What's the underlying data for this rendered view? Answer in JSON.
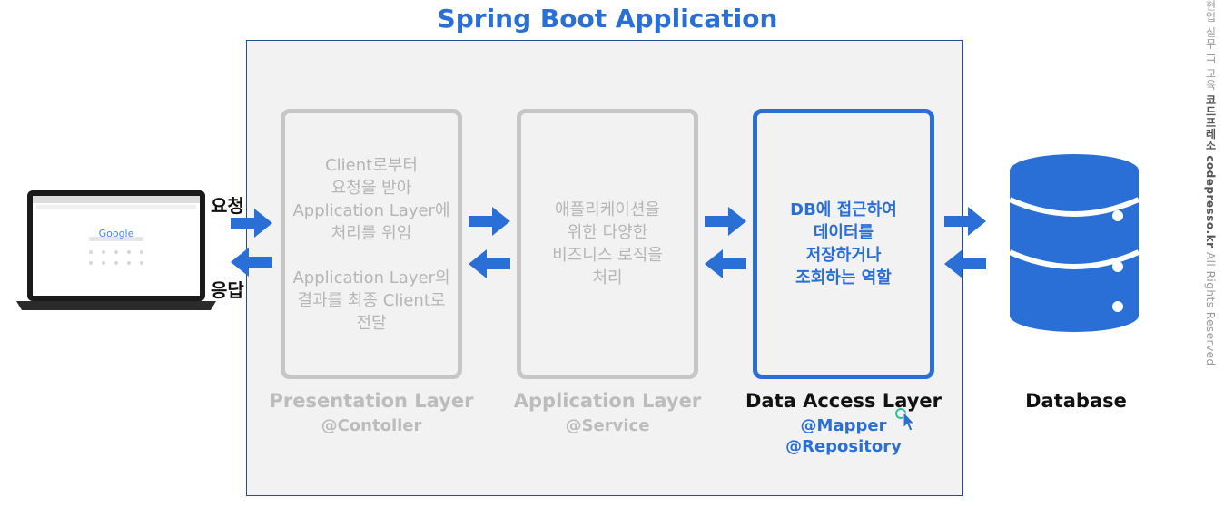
{
  "title": "Spring Boot Application",
  "client": {
    "request_label": "요청",
    "response_label": "응답",
    "screen_brand": "Google"
  },
  "layers": [
    {
      "name": "Presentation Layer",
      "annotations": [
        "@Contoller"
      ],
      "description_1": [
        "Client로부터",
        "요청을 받아",
        "Application Layer에",
        "처리를 위임"
      ],
      "description_2": [
        "Application Layer의",
        "결과를 최종 Client로",
        "전달"
      ]
    },
    {
      "name": "Application Layer",
      "annotations": [
        "@Service"
      ],
      "description_1": [
        "애플리케이션을",
        "위한 다양한",
        "비즈니스 로직을",
        "처리"
      ]
    },
    {
      "name": "Data Access Layer",
      "annotations": [
        "@Mapper",
        "@Repository"
      ],
      "description_1": [
        "DB에 접근하여",
        "데이터를",
        "저장하거나",
        "조회하는 역할"
      ]
    }
  ],
  "database": {
    "label": "Database"
  },
  "watermark": {
    "prefix": "현업 실무 IT 교육",
    "brand": "코드프레소 codepresso.kr",
    "suffix": "All Rights Reserved"
  },
  "colors": {
    "accent": "#2a6fd6",
    "inactive": "#bcbcbc",
    "frame_bg": "#f2f2f2"
  }
}
